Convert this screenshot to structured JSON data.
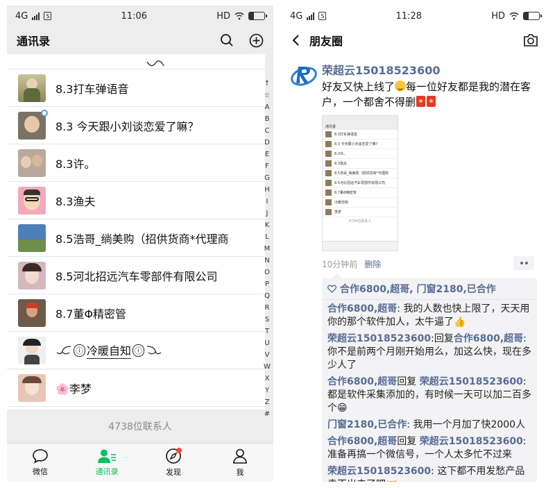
{
  "left": {
    "status": {
      "network": "4G",
      "time": "11:06",
      "hd": "HD"
    },
    "title": "通讯录",
    "contacts": [
      {
        "name": "8.3打车弹语音",
        "avatar_color": "#a9a06a"
      },
      {
        "name": "8.3 今天跟小刘谈恋爱了嘛？",
        "avatar_color": "#7b7266"
      },
      {
        "name": "8.3许。",
        "avatar_color": "#b9a99b"
      },
      {
        "name": "8.3渔夫",
        "avatar_color": "#f2a9b9"
      },
      {
        "name": "8.5浩哥_绱美购（招供货商*代理商",
        "avatar_color": "#5a7fa8"
      },
      {
        "name": "8.5河北招远汽车零部件有限公司",
        "avatar_color": "#c9a2a8"
      },
      {
        "name": "8.7董Φ精密管",
        "avatar_color": "#6d5a49"
      },
      {
        "name": "冷暖自知",
        "avatar_color": "#dedede"
      },
      {
        "name": "🌸李梦",
        "avatar_color": "#e8c6b6"
      }
    ],
    "index_letters": [
      "↑",
      "☆",
      "A",
      "B",
      "C",
      "D",
      "E",
      "F",
      "G",
      "H",
      "I",
      "J",
      "K",
      "L",
      "M",
      "N",
      "O",
      "P",
      "Q",
      "R",
      "S",
      "T",
      "U",
      "V",
      "W",
      "X",
      "Y",
      "Z",
      "#"
    ],
    "contact_count": "4738位联系人",
    "tabs": [
      {
        "label": "微信"
      },
      {
        "label": "通讯录"
      },
      {
        "label": "发现"
      },
      {
        "label": "我"
      }
    ]
  },
  "right": {
    "status": {
      "network": "4G",
      "time": "11:28",
      "hd": "HD"
    },
    "title": "朋友圈",
    "post": {
      "author": "荣超云15018523600",
      "text_1": "好友又快上线了",
      "text_2": "每一位好友都是我的潜在客户，一个都舍不得删",
      "time_ago": "10分钟前",
      "delete_label": "删除",
      "thumb": {
        "title": "通讯录",
        "rows": [
          "8.3打车弹语音",
          "8.3 今天跟小刘谈恋爱了嘛?",
          "8.3许。",
          "8.3渔夫",
          "8.5浩哥_绱美购（招供货商*代理商",
          "8.5河北招远汽车零部件有限公司",
          "8.7董Φ精密管",
          "冷暖自知",
          "李梦"
        ],
        "count": "4738位联系人"
      },
      "likes": "合作6800,超哥, 门窗2180,已合作",
      "comments": [
        {
          "user": "合作6800,超哥",
          "text": ": 我的人数也快上限了，天天用你的那个软件加人，太牛逼了"
        },
        {
          "user": "荣超云15018523600",
          "reply_word": ":回复",
          "target": "合作6800,超哥",
          "text": ": 你不是前两个月刚开始用么，加这么快，现在多少人了"
        },
        {
          "user": "合作6800,超哥",
          "reply_word": "回复",
          "target": "荣超云15018523600",
          "text": ": 都是软件采集添加的，有时候一天可以加二百多个"
        },
        {
          "user": "门窗2180,已合作",
          "text": ": 我用一个月加了快2000人"
        },
        {
          "user": "合作6800,超哥",
          "reply_word": "回复",
          "target": "荣超云15018523600",
          "text": ": 准备再搞一个微信号，一个人太多忙不过来"
        },
        {
          "user": "荣超云15018523600",
          "text": ": 这下都不用发愁产品卖不出去了吧"
        }
      ]
    }
  },
  "colors": {
    "wechat_green": "#07c160",
    "link_blue": "#576b95"
  }
}
